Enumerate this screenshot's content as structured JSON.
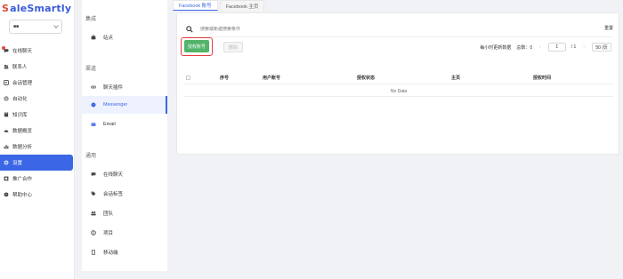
{
  "brand": {
    "name": "aleSmartly",
    "mark": "S"
  },
  "workspace": {
    "name": "■■"
  },
  "nav": {
    "items": [
      {
        "label": "在线聊天",
        "icon": "chat-icon"
      },
      {
        "label": "联系人",
        "icon": "contacts-icon"
      },
      {
        "label": "会话管理",
        "icon": "conversation-icon"
      },
      {
        "label": "自动化",
        "icon": "automation-icon"
      },
      {
        "label": "知识库",
        "icon": "book-icon"
      },
      {
        "label": "数据概览",
        "icon": "dashboard-icon"
      },
      {
        "label": "数据分析",
        "icon": "chart-icon"
      },
      {
        "label": "设置",
        "icon": "gear-icon"
      },
      {
        "label": "推广合作",
        "icon": "share-icon"
      },
      {
        "label": "帮助中心",
        "icon": "help-icon"
      }
    ]
  },
  "subnav": {
    "groups": [
      {
        "title": "集成"
      },
      {
        "title": "渠道"
      },
      {
        "title": "通用"
      }
    ],
    "items": [
      {
        "label": "站点"
      },
      {
        "label": "聊天插件"
      },
      {
        "label": "Messenger"
      },
      {
        "label": "Email"
      },
      {
        "label": "在线聊天"
      },
      {
        "label": "会话标签"
      },
      {
        "label": "团队"
      },
      {
        "label": "项目"
      },
      {
        "label": "移动端"
      }
    ]
  },
  "tabs": [
    {
      "label": "Facebook 账号"
    },
    {
      "label": "Facebook 主页"
    }
  ],
  "search": {
    "placeholder": "搜索或新建搜索条件"
  },
  "toolbar": {
    "reset_label": "重置",
    "auth_label": "授权账号",
    "delete_label": "删除"
  },
  "pagination": {
    "update_hint": "每小时更新数据",
    "total": "总数：0",
    "page": "1",
    "pages": "/ 1",
    "page_size": "50 /页"
  },
  "table": {
    "columns": [
      "序号",
      "用户账号",
      "授权状态",
      "主页",
      "授权时间"
    ],
    "empty": "No Data"
  },
  "colors": {
    "accent": "#3b66e5",
    "auth_button": "#52b36a",
    "highlight": "#e53e3e"
  }
}
